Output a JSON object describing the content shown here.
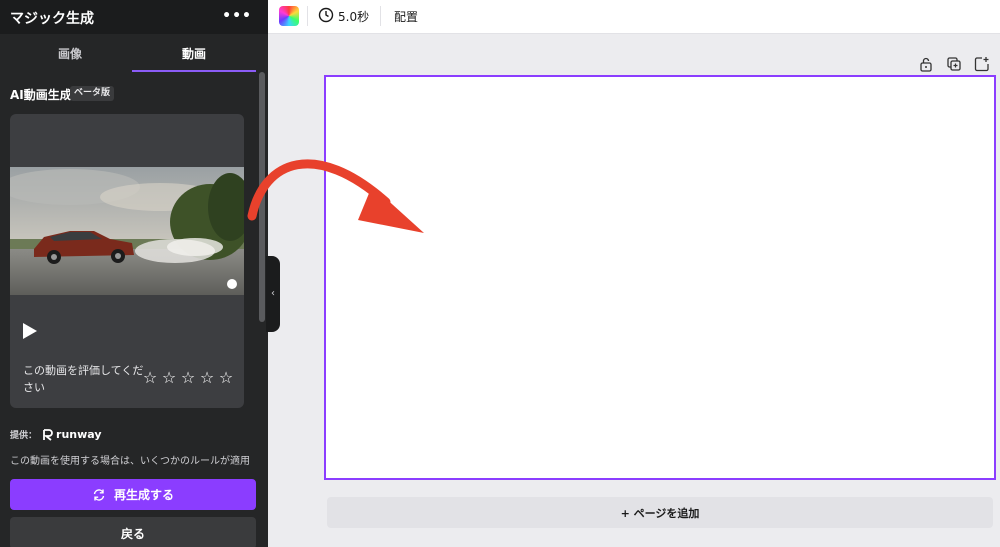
{
  "panel": {
    "title": "マジック生成",
    "more_label": "•••",
    "tabs": [
      {
        "label": "画像",
        "active": false
      },
      {
        "label": "動画",
        "active": true
      }
    ],
    "section_title": "AI動画生成",
    "beta_badge": "ベータ版",
    "rating_prompt": "この動画を評価してください",
    "stars": [
      "☆",
      "☆",
      "☆",
      "☆",
      "☆"
    ],
    "provider_prefix": "提供：",
    "provider_name": "runway",
    "usage_text": "この動画を使用する場合は、いくつかのルールが適用",
    "regenerate_label": "再生成する",
    "back_label": "戻る"
  },
  "toolbar": {
    "duration": "5.0秒",
    "arrange_label": "配置"
  },
  "canvas": {
    "add_page_label": "+ ページを追加"
  },
  "colors": {
    "accent": "#8b3dff",
    "annotation_arrow": "#e8412c",
    "panel_bg": "#252627"
  },
  "icons": {
    "more": "more-dots-icon",
    "play": "play-icon",
    "star": "star-outline-icon",
    "regenerate": "refresh-icon",
    "clock": "clock-icon",
    "lock": "lock-icon",
    "duplicate": "duplicate-icon",
    "add_page": "add-page-icon",
    "collapse": "chevron-left-icon"
  }
}
